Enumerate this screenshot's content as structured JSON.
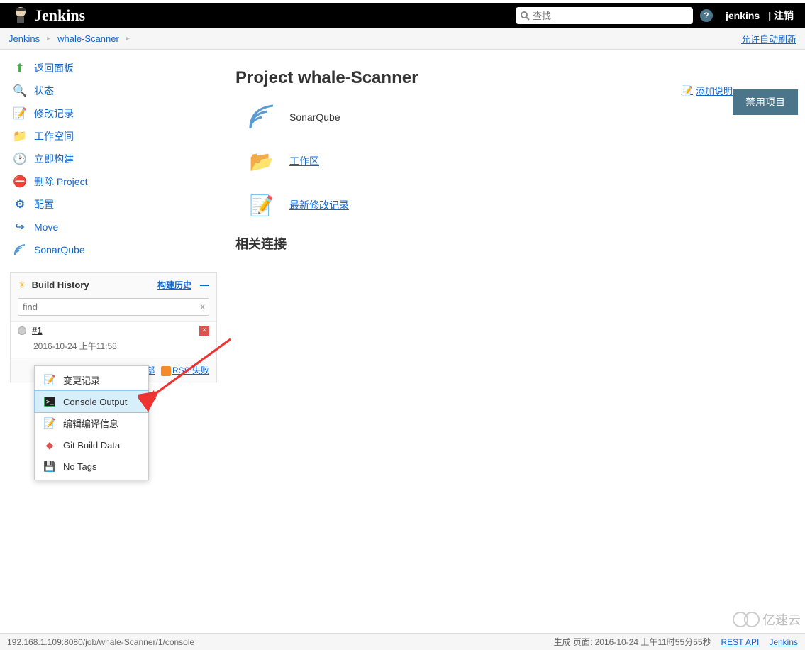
{
  "header": {
    "brand": "Jenkins",
    "search_placeholder": "查找",
    "username": "jenkins",
    "logout": "注销"
  },
  "breadcrumbs": {
    "root": "Jenkins",
    "project": "whale-Scanner",
    "autorefresh": "允许自动刷新"
  },
  "sidebar": {
    "back": "返回面板",
    "status": "状态",
    "changes": "修改记录",
    "workspace": "工作空间",
    "build_now": "立即构建",
    "delete": "删除 Project",
    "configure": "配置",
    "move": "Move",
    "sonar": "SonarQube"
  },
  "history": {
    "title": "Build History",
    "trend": "构建历史",
    "find_placeholder": "find",
    "build_num": "#1",
    "build_date": "2016-10-24 上午11:58",
    "rss_all": "RSS 全部",
    "rss_fail": "RSS 失败"
  },
  "popup": {
    "changes": "变更记录",
    "console": "Console Output",
    "editinfo": "编辑编译信息",
    "gitdata": "Git Build Data",
    "notags": "No Tags"
  },
  "main": {
    "title": "Project whale-Scanner",
    "add_desc": "添加说明",
    "disable": "禁用项目",
    "sonar": "SonarQube",
    "workspace": "工作区",
    "recent_changes": "最新修改记录",
    "related": "相关连接"
  },
  "footer": {
    "url": "192.168.1.109:8080/job/whale-Scanner/1/console",
    "generated": "生成 页面: 2016-10-24 上午11时55分55秒",
    "rest": "REST API",
    "brand": "Jenkins"
  },
  "watermark": "亿速云"
}
